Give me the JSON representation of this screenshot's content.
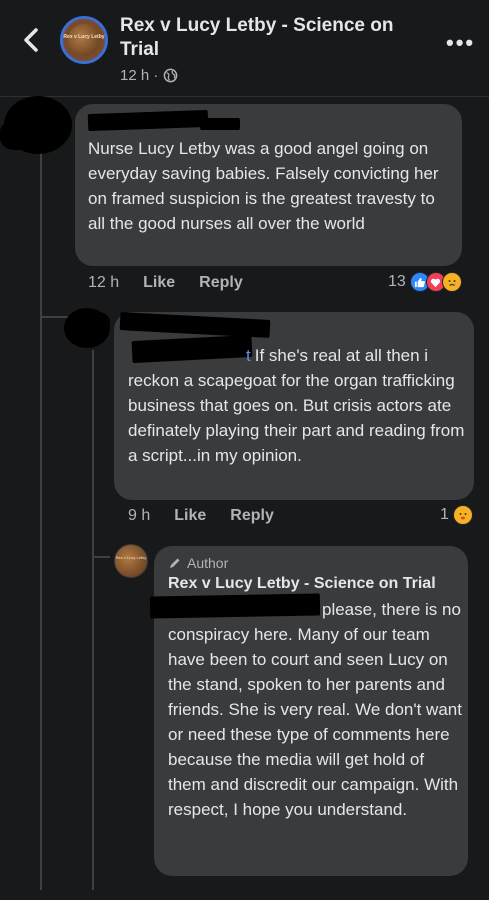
{
  "header": {
    "back_icon": "chevron-left-icon",
    "group_title": "Rex v Lucy Letby - Science on Trial",
    "group_avatar_text": "Rex v Lucy Letby",
    "time": "12 h ·",
    "privacy_icon": "globe-icon",
    "more_label": "•••"
  },
  "comments": [
    {
      "text": "Nurse Lucy Letby was a good angel going on everyday saving babies. Falsely convicting her on framed suspicion is the greatest travesty to all the good nurses all over the world",
      "time": "12 h",
      "like_label": "Like",
      "reply_label": "Reply",
      "reaction_count": "13",
      "reactions": [
        "like",
        "love",
        "sad"
      ]
    },
    {
      "mention_tail": "t",
      "text": "If she's real at all then i reckon a scapegoat for the organ trafficking business that goes on. But crisis actors ate definately playing their part and reading from a script...in my opinion.",
      "time": "9 h",
      "like_label": "Like",
      "reply_label": "Reply",
      "reaction_count": "1",
      "reactions": [
        "angry-face"
      ]
    },
    {
      "author_badge": "Author",
      "author_name": "Rex v Lucy Letby - Science on Trial",
      "text": "please, there is no conspiracy here. Many of our team have been to court and seen Lucy on the stand, spoken to her parents and friends. She is very real. We don't want or need these type of comments here because the media will get hold of them and discredit our campaign. With respect, I hope you understand.",
      "avatar_text": "Rex v Lucy Letby"
    }
  ],
  "colors": {
    "background": "#18191a",
    "bubble": "#3a3b3c",
    "text": "#e4e6eb",
    "muted": "#b0b3b8",
    "like_blue": "#2d88ff",
    "love_red": "#f33e58",
    "sad_yellow": "#f7b125"
  }
}
